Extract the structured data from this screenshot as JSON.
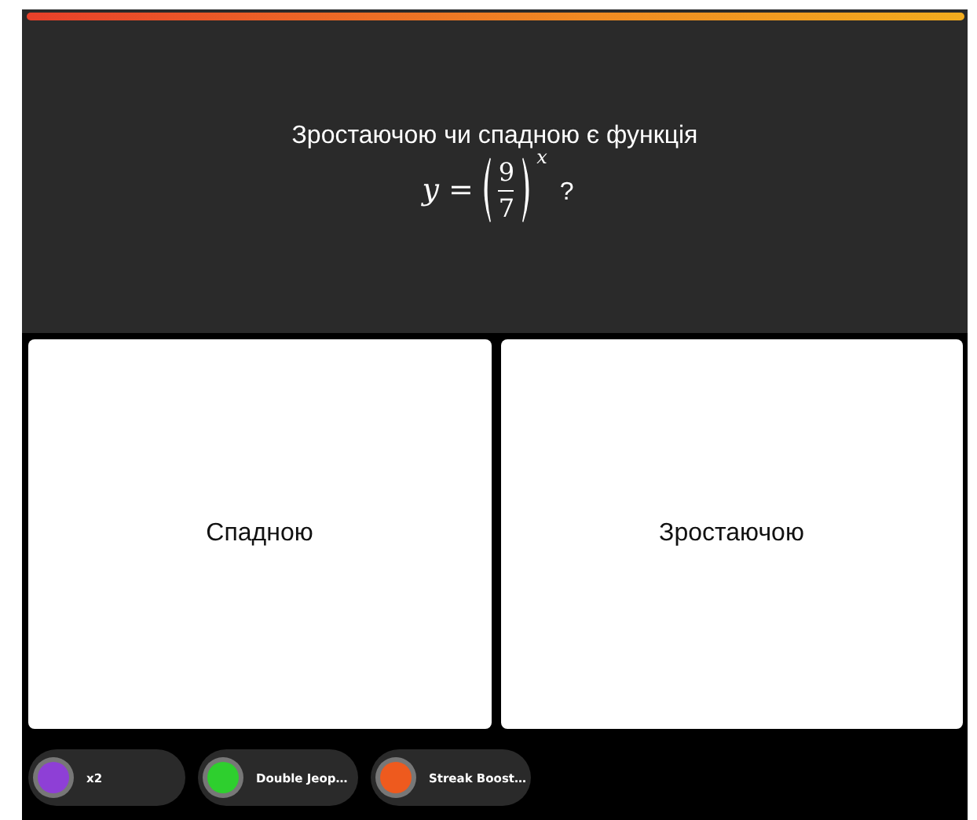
{
  "timer": {
    "level": 1
  },
  "question": {
    "text": "Зростаючою чи спадною є функція",
    "formula": {
      "variable": "y",
      "equals": "=",
      "numerator": "9",
      "denominator": "7",
      "exponent": "x",
      "end": "?"
    }
  },
  "answers": [
    {
      "label": "Спадною"
    },
    {
      "label": "Зростаючою"
    }
  ],
  "powerups": [
    {
      "label": "x2",
      "color": "#8e3fd6"
    },
    {
      "label": "Double Jeop…",
      "color": "#2ecf2e"
    },
    {
      "label": "Streak Boost…",
      "color": "#ee5a1e"
    }
  ]
}
